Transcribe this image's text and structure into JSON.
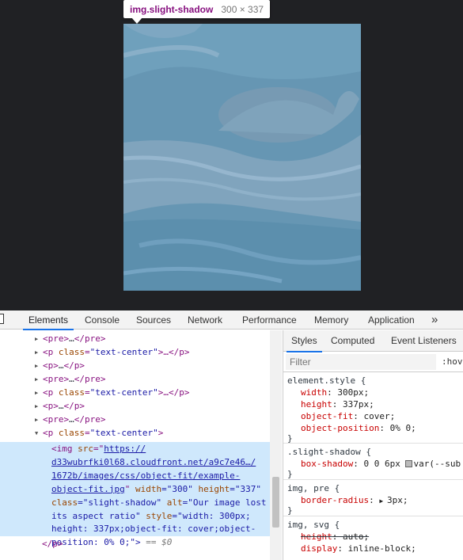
{
  "tooltip": {
    "tag": "img.slight-shadow",
    "size": "300 × 337"
  },
  "devtools": {
    "tabs": [
      "Elements",
      "Console",
      "Sources",
      "Network",
      "Performance",
      "Memory",
      "Application"
    ],
    "more": "»"
  },
  "dom": {
    "lines": [
      {
        "open": "<pre>",
        "mid": "…",
        "close": "</pre>"
      },
      {
        "open": "<p ",
        "attr": "class",
        "val": "\"text-center\"",
        "tail": ">…</p>"
      },
      {
        "open": "<p>",
        "mid": "…",
        "close": "</p>"
      },
      {
        "open": "<pre>",
        "mid": "…",
        "close": "</pre>"
      },
      {
        "open": "<p ",
        "attr": "class",
        "val": "\"text-center\"",
        "tail": ">…</p>"
      },
      {
        "open": "<p>",
        "mid": "…",
        "close": "</p>"
      },
      {
        "open": "<pre>",
        "mid": "…",
        "close": "</pre>"
      },
      {
        "open": "<p ",
        "attr": "class",
        "val": "\"text-center\"",
        "tail": ">"
      }
    ],
    "selected": {
      "l1_tag": "<img ",
      "l1_attr": "src",
      "l1_eq": "=\"",
      "l1_link": "https://",
      "l2_link": "d33wubrfki0l68.cloudfront.net/a9c7e46…/",
      "l3_link": "1672b/images/css/object-fit/example-",
      "l4_link": "object-fit.jpg",
      "l4_q": "\" ",
      "l4_a1": "width",
      "l4_v1": "=\"300\" ",
      "l4_a2": "height",
      "l4_v2": "=\"337\"",
      "l5_a1": "class",
      "l5_v1": "=\"slight-shadow\" ",
      "l5_a2": "alt",
      "l5_v2": "=\"Our image lost",
      "l6_v": "its aspect ratio\" ",
      "l6_a": "style",
      "l6_v2": "=\"width: 300px;",
      "l7_v": "height: 337px;object-fit: cover;object-",
      "l8_v": "position: 0% 0;\">",
      "l8_tail": " == $0"
    },
    "close_p": "</p>"
  },
  "styles": {
    "tabs": [
      "Styles",
      "Computed",
      "Event Listeners"
    ],
    "filter_placeholder": "Filter",
    "hov": ":hov",
    "rules": [
      {
        "selector": "element.style {",
        "decls": [
          {
            "prop": "width",
            "value": "300px;"
          },
          {
            "prop": "height",
            "value": "337px;"
          },
          {
            "prop": "object-fit",
            "value": "cover;"
          },
          {
            "prop": "object-position",
            "value": "0% 0;"
          }
        ],
        "close": "}"
      },
      {
        "selector": ".slight-shadow {",
        "decls": [
          {
            "prop": "box-shadow",
            "value_pre": "0 0 6px ",
            "value_post": "var(--sub"
          }
        ],
        "close": "}"
      },
      {
        "selector": "img, pre {",
        "decls": [
          {
            "prop": "border-radius",
            "value_pre": "▶ ",
            "value_post": "3px;"
          }
        ],
        "close": "}"
      },
      {
        "selector": "img, svg {",
        "decls": [
          {
            "prop": "height",
            "value": "auto;"
          },
          {
            "prop": "display",
            "value": "inline-block;"
          }
        ]
      }
    ]
  },
  "colors": {
    "highlight": "#6fa8dc",
    "selected_row": "#cfe8fc",
    "tag": "#881280",
    "attr": "#994500",
    "value": "#1a1aa6",
    "accent": "#1a73e8"
  }
}
